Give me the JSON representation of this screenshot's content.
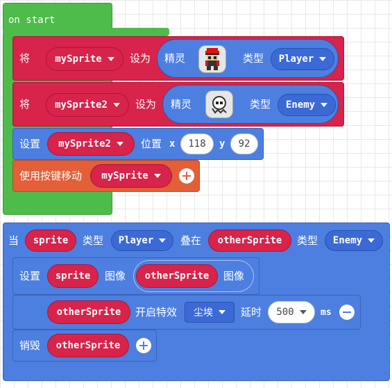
{
  "on_start": {
    "hat_label": "on start",
    "set1": {
      "verb": "将",
      "var": "mySprite",
      "setto": "设为",
      "sprite_label": "精灵",
      "kind_label": "类型",
      "kind": "Player",
      "image_icon": "player-sprite-icon"
    },
    "set2": {
      "verb": "将",
      "var": "mySprite2",
      "setto": "设为",
      "sprite_label": "精灵",
      "kind_label": "类型",
      "kind": "Enemy",
      "image_icon": "ghost-sprite-icon"
    },
    "setpos": {
      "label": "设置",
      "var": "mySprite2",
      "pos_label": "位置",
      "x_label": "x",
      "x": "118",
      "y_label": "y",
      "y": "92"
    },
    "move": {
      "label": "使用按键移动",
      "var": "mySprite"
    }
  },
  "overlap": {
    "when": "当",
    "sprite": "sprite",
    "kind_label1": "类型",
    "kind1": "Player",
    "overlaps": "叠在",
    "other": "otherSprite",
    "kind_label2": "类型",
    "kind2": "Enemy",
    "setimg": {
      "label": "设置",
      "sprite": "sprite",
      "image_label": "图像",
      "other": "otherSprite",
      "image_label2": "图像"
    },
    "effect": {
      "other": "otherSprite",
      "start_label": "开启特效",
      "effect": "尘埃",
      "delay_label": "延时",
      "ms": "500",
      "ms_label": "ms"
    },
    "destroy": {
      "label": "销毁",
      "other": "otherSprite"
    }
  },
  "colors": {
    "event_green": "#4ebc4a",
    "sprites_red": "#d8234a",
    "sprites_blue": "#4c7fe0",
    "controller_orange": "#e35f38"
  }
}
